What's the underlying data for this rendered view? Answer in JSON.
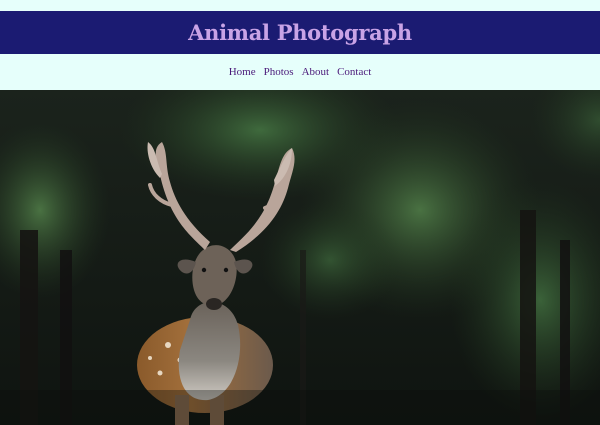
{
  "site": {
    "title": "Animal Photograph"
  },
  "nav": {
    "items": [
      {
        "label": "Home"
      },
      {
        "label": "Photos"
      },
      {
        "label": "About"
      },
      {
        "label": "Contact"
      }
    ]
  },
  "hero": {
    "image_alt": "deer-in-forest"
  },
  "colors": {
    "header_bg": "#1b1b72",
    "title": "#c9a3e6",
    "page_bg": "#e6fffb",
    "nav_link": "#4b1a7a"
  }
}
